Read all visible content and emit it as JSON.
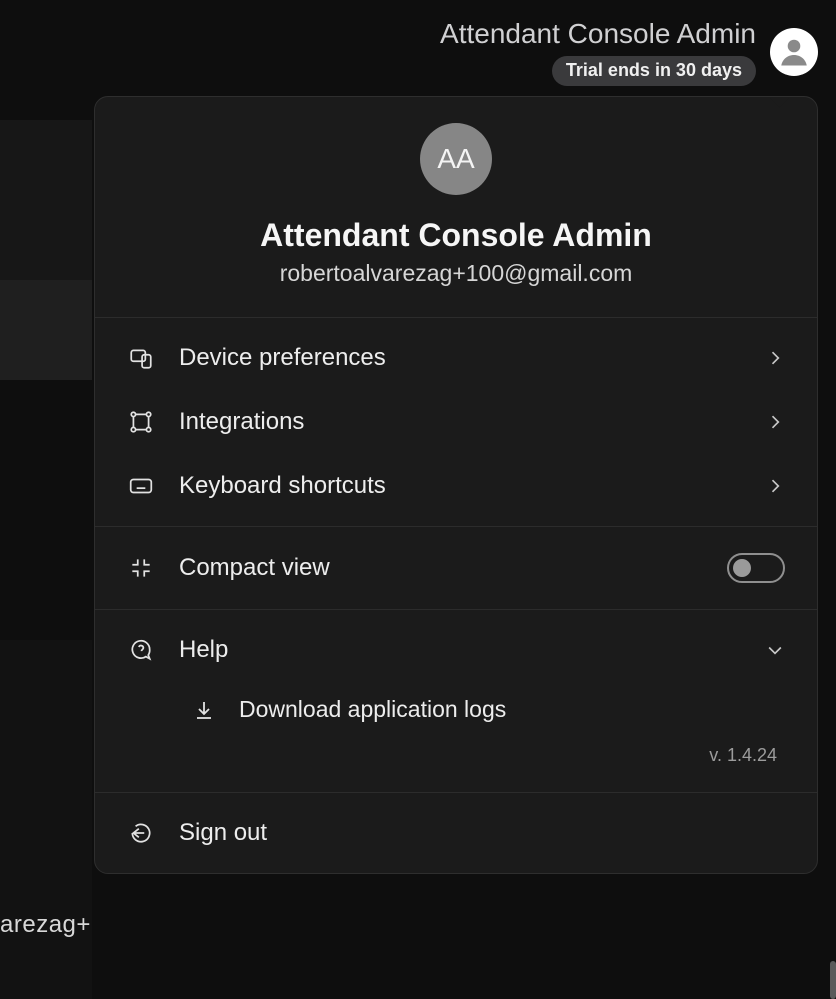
{
  "header": {
    "title": "Attendant Console Admin",
    "trial_badge": "Trial ends in 30 days"
  },
  "background": {
    "partial_text": "arezag+"
  },
  "profile": {
    "initials": "AA",
    "name": "Attendant Console Admin",
    "email": "robertoalvarezag+100@gmail.com"
  },
  "menu": {
    "device_preferences": "Device preferences",
    "integrations": "Integrations",
    "keyboard_shortcuts": "Keyboard shortcuts",
    "compact_view": "Compact view",
    "compact_view_on": false,
    "help": "Help",
    "help_expanded": true,
    "download_logs": "Download application logs",
    "sign_out": "Sign out"
  },
  "version": "v. 1.4.24"
}
